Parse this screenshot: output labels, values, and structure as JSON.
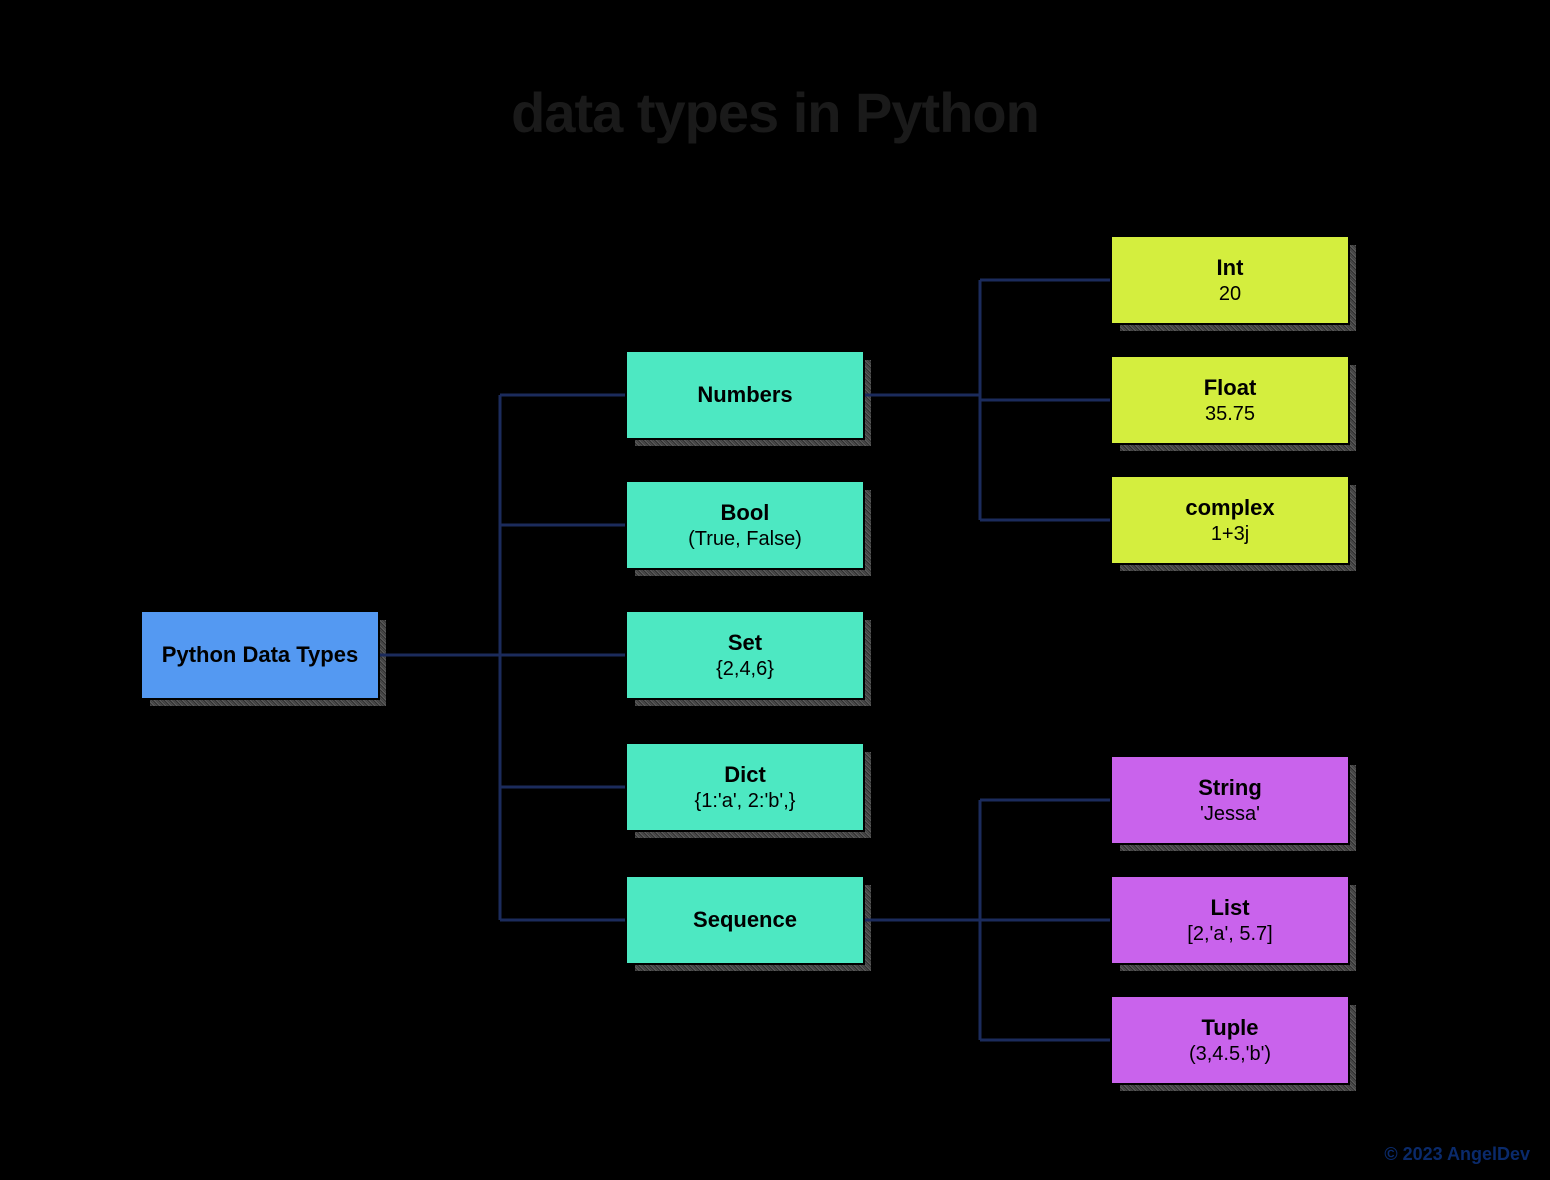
{
  "title": "data types in Python",
  "root": {
    "label": "Python Data Types"
  },
  "middle": {
    "numbers": {
      "label": "Numbers"
    },
    "bool": {
      "label": "Bool",
      "example": "(True, False)"
    },
    "set": {
      "label": "Set",
      "example": "{2,4,6}"
    },
    "dict": {
      "label": "Dict",
      "example": "{1:'a', 2:'b',}"
    },
    "sequence": {
      "label": "Sequence"
    }
  },
  "numbers_children": {
    "int": {
      "label": "Int",
      "example": "20"
    },
    "float": {
      "label": "Float",
      "example": "35.75"
    },
    "complex": {
      "label": "complex",
      "example": "1+3j"
    }
  },
  "sequence_children": {
    "string": {
      "label": "String",
      "example": "'Jessa'"
    },
    "list": {
      "label": "List",
      "example": "[2,'a', 5.7]"
    },
    "tuple": {
      "label": "Tuple",
      "example": "(3,4.5,'b')"
    }
  },
  "attribution": "© 2023 AngelDev"
}
